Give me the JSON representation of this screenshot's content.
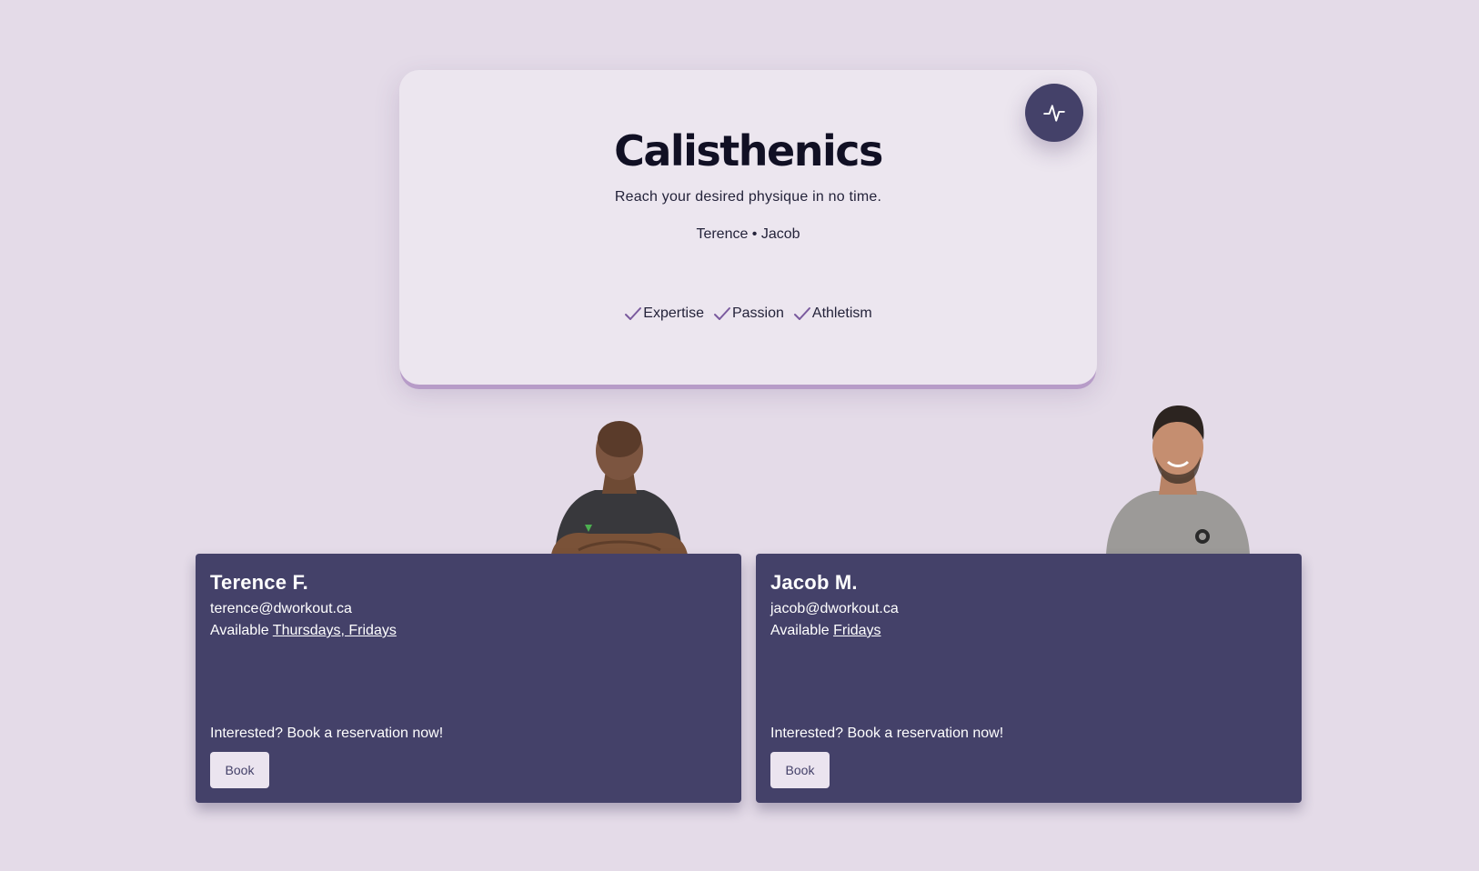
{
  "hero": {
    "title": "Calisthenics",
    "subtitle": "Reach your desired physique in no time.",
    "coaches": "Terence • Jacob",
    "action_icon": "activity-pulse-icon",
    "features": [
      {
        "label": "Expertise",
        "icon": "check-icon"
      },
      {
        "label": "Passion",
        "icon": "check-icon"
      },
      {
        "label": "Athletism",
        "icon": "check-icon"
      }
    ]
  },
  "trainers": [
    {
      "name": "Terence F.",
      "email": "terence@dworkout.ca",
      "available_prefix": "Available",
      "available_days": "Thursdays, Fridays",
      "cta": "Interested? Book a reservation now!",
      "book_label": "Book",
      "shirt_color": "#3a3a3e"
    },
    {
      "name": "Jacob M.",
      "email": "jacob@dworkout.ca",
      "available_prefix": "Available",
      "available_days": "Fridays",
      "cta": "Interested? Book a reservation now!",
      "book_label": "Book",
      "shirt_color": "#9c9a98"
    }
  ],
  "colors": {
    "page_background": "#e4dbe8",
    "hero_background": "#ece6ef",
    "card_background": "#444169",
    "check_accent": "#7a5a9e",
    "button_background": "#ebe4ef"
  }
}
